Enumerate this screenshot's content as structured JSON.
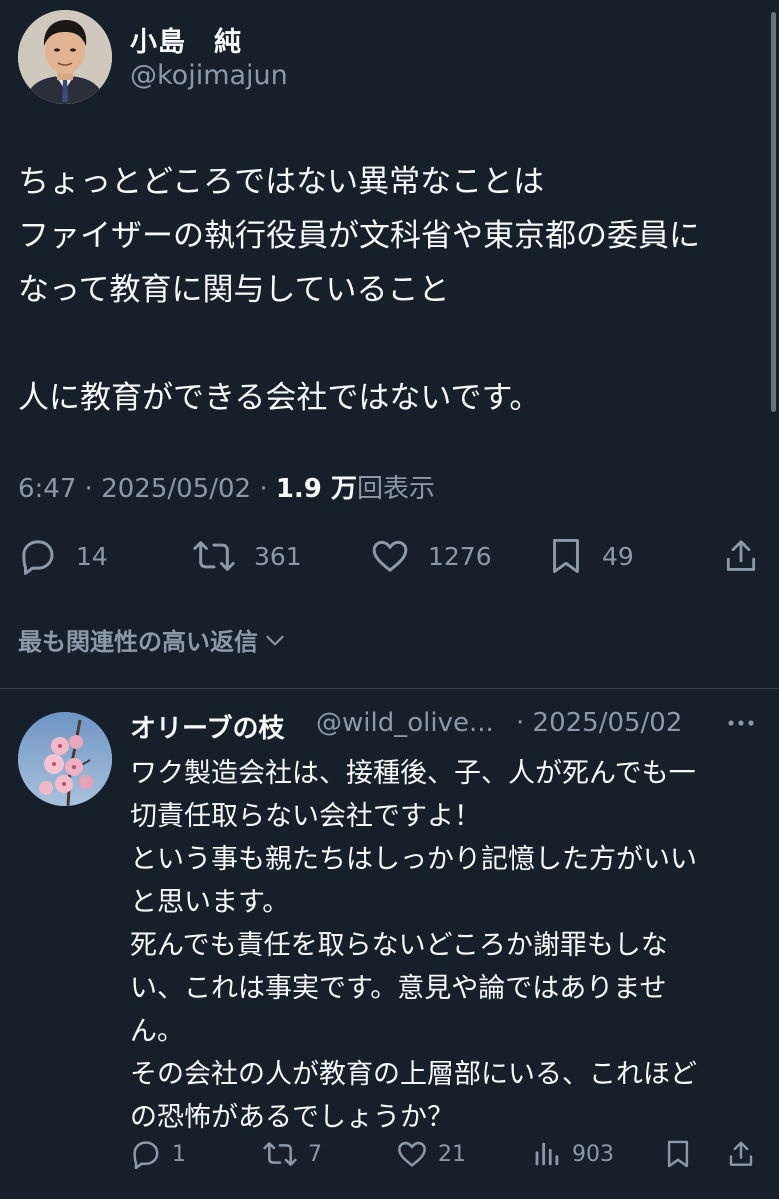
{
  "main_tweet": {
    "author_name": "小島　純",
    "author_handle": "@kojimajun",
    "text_lines": [
      "ちょっとどころではない異常なことは",
      "ファイザーの執行役員が文科省や東京都の委員に",
      "なって教育に関与していること",
      "",
      "人に教育ができる会社ではないです。"
    ],
    "time": "6:47",
    "separator": "·",
    "date": "2025/05/02",
    "views_count": "1.9 万",
    "views_label": "回表示",
    "replies": "14",
    "retweets": "361",
    "likes": "1276",
    "bookmarks": "49"
  },
  "related_replies_label": "最も関連性の高い返信",
  "reply": {
    "author_name": "オリーブの枝",
    "author_handle": "@wild_olive...",
    "date": "· 2025/05/02",
    "text_lines": [
      "ワク製造会社は、接種後、子、人が死んでも一",
      "切責任取らない会社ですよ！",
      "という事も親たちはしっかり記憶した方がいい",
      "と思います。",
      "死んでも責任を取らないどころか謝罪もしな",
      "い、これは事実です。意見や論ではありませ",
      "ん。",
      "その会社の人が教育の上層部にいる、これほど",
      "の恐怖があるでしょうか？"
    ],
    "replies": "1",
    "retweets": "7",
    "likes": "21",
    "views": "903"
  },
  "colors": {
    "background": "#15202b",
    "text_primary": "#f7f9f9",
    "text_secondary": "#8b98a5",
    "divider": "#38444d"
  },
  "icons": [
    "reply-icon",
    "retweet-icon",
    "like-icon",
    "bookmark-icon",
    "share-icon",
    "views-icon",
    "more-icon",
    "chevron-down-icon"
  ]
}
